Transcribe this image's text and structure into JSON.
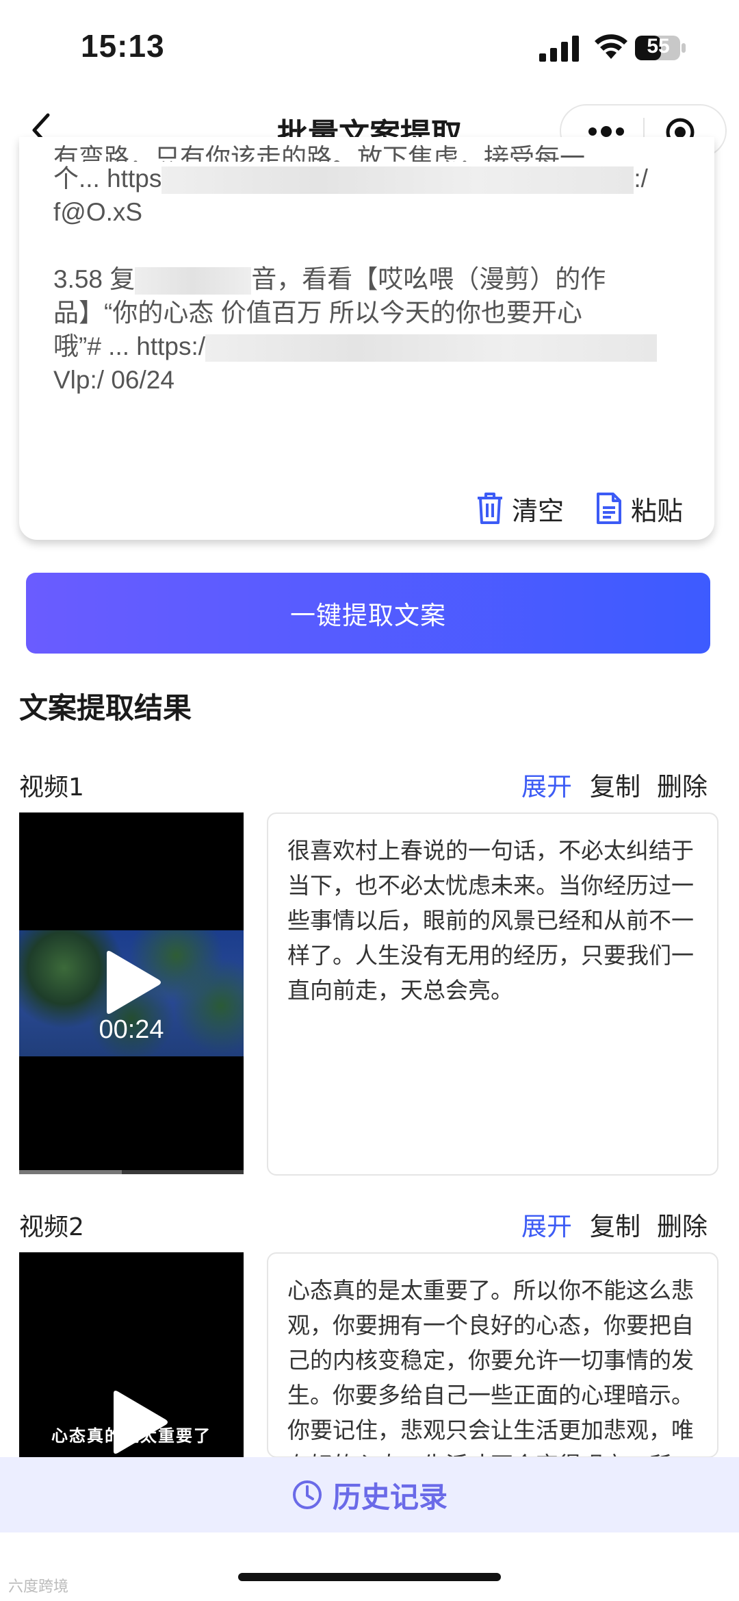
{
  "status_bar": {
    "time": "15:13",
    "battery": "55"
  },
  "nav": {
    "title": "批量文案提取"
  },
  "input": {
    "line_partial": "有弯路，只有你该走的路。放下焦虑，接受每一",
    "entry1_a": "个... https",
    "entry1_b": ":/",
    "entry1_c": "f@O.xS",
    "entry2_a": "3.58 复",
    "entry2_b": "音，看看【哎吆喂（漫剪）的作",
    "entry2_c": "品】“你的心态 价值百万 所以今天的你也要开心",
    "entry2_d": "哦”# ... https:/",
    "entry2_e": "Vlp:/ 06/24",
    "clear_label": "清空",
    "paste_label": "粘贴"
  },
  "extract_button": "一键提取文案",
  "results": {
    "title": "文案提取结果",
    "videos": [
      {
        "label": "视频1",
        "expand": "展开",
        "copy": "复制",
        "delete": "删除",
        "duration": "00:24",
        "text": "很喜欢村上春说的一句话，不必太纠结于当下，也不必太忧虑未来。当你经历过一些事情以后，眼前的风景已经和从前不一样了。人生没有无用的经历，只要我们一直向前走，天总会亮。"
      },
      {
        "label": "视频2",
        "expand": "展开",
        "copy": "复制",
        "delete": "删除",
        "caption": "心态真的是太重要了",
        "text": "心态真的是太重要了。所以你不能这么悲观，你要拥有一个良好的心态，你要把自己的内核变稳定，你要允许一切事情的发生。你要多给自己一些正面的心理暗示。你要记住，悲观只会让生活更加悲观，唯有好的心态，生活才不会变得艰辛。所"
      }
    ]
  },
  "history_button": "历史记录",
  "watermark": "六度跨境",
  "colors": {
    "accent": "#3c5bf5",
    "button_start": "#6a5cff",
    "button_end": "#3d5bff",
    "history_bg": "#eceeff"
  }
}
